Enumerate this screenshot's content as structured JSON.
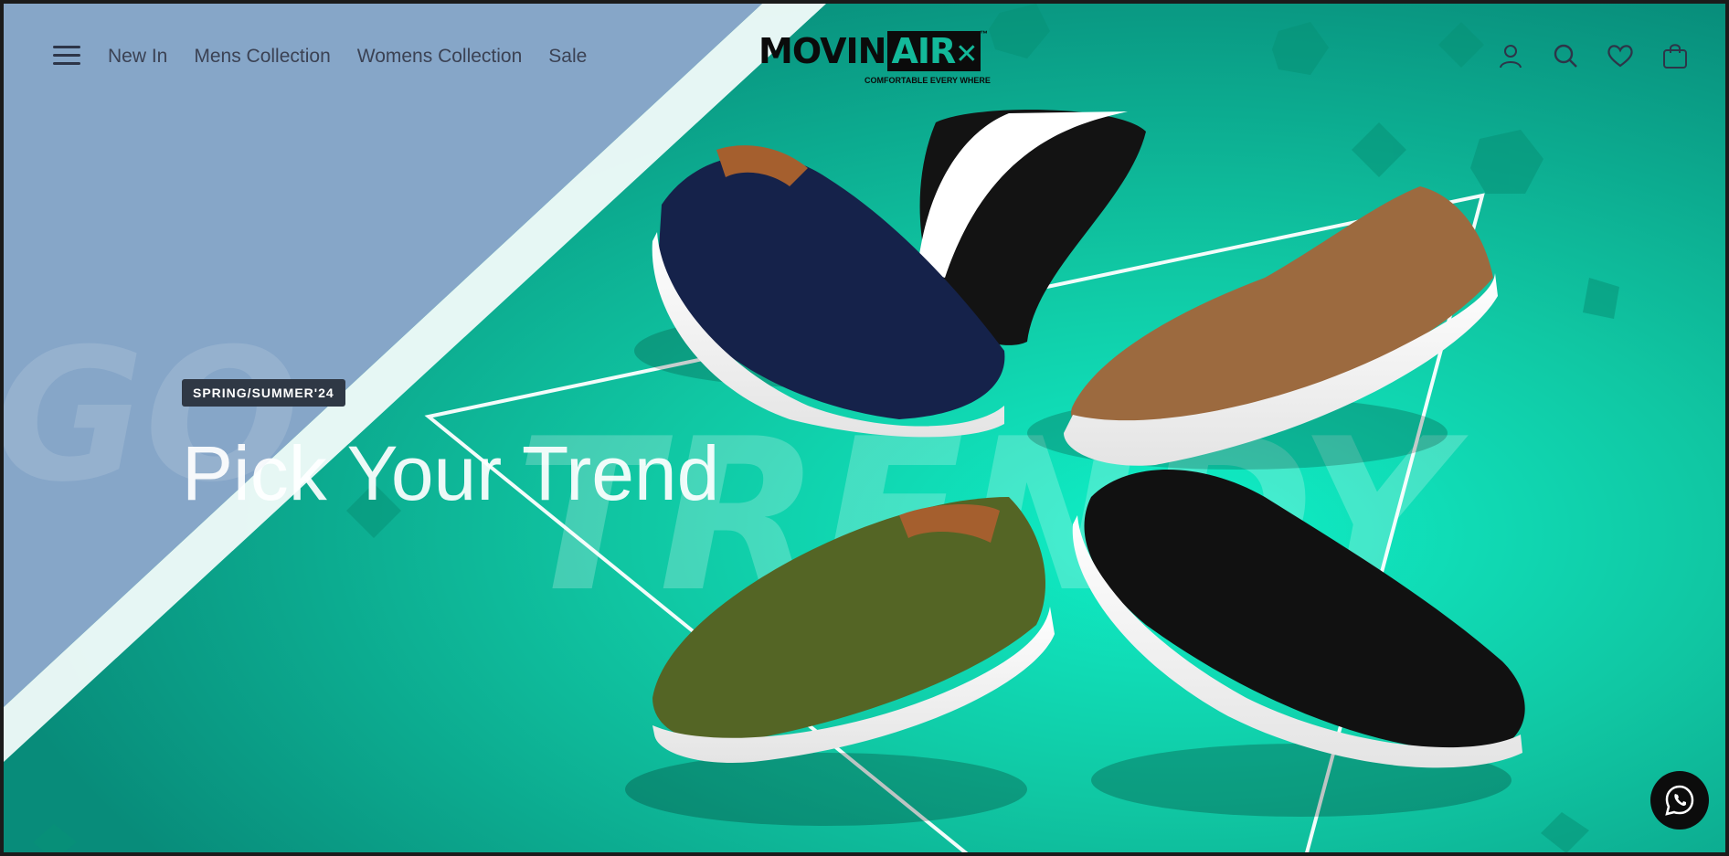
{
  "nav": {
    "menu_icon": "hamburger-menu-icon",
    "items": [
      {
        "label": "New In"
      },
      {
        "label": "Mens Collection"
      },
      {
        "label": "Womens Collection"
      },
      {
        "label": "Sale"
      }
    ]
  },
  "brand": {
    "logo_part1": "MOVIN",
    "logo_part2": "AIR",
    "trademark": "™",
    "tagline": "COMFORTABLE EVERY WHERE"
  },
  "header_icons": [
    "user-icon",
    "search-icon",
    "heart-icon",
    "shopping-bag-icon"
  ],
  "hero": {
    "badge": "SPRING/SUMMER'24",
    "headline": "Pick Your Trend",
    "watermark_left": "GO",
    "watermark_main": "TRENDY",
    "shoe_colors": [
      "navy",
      "black",
      "tan",
      "olive",
      "black"
    ]
  },
  "floating": {
    "whatsapp_icon": "whatsapp-icon"
  },
  "colors": {
    "teal": "#11b99a",
    "slate_blue": "#86a6c8",
    "dark": "#1b1b1b"
  }
}
